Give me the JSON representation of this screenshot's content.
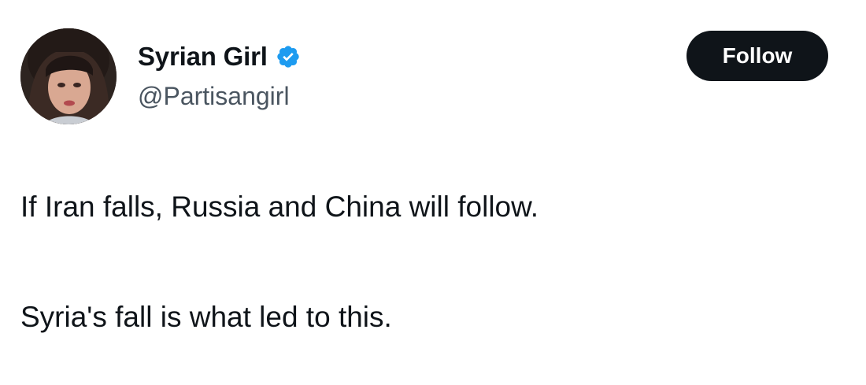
{
  "author": {
    "display_name": "Syrian Girl",
    "handle": "@Partisangirl",
    "verified": true
  },
  "follow_button": {
    "label": "Follow"
  },
  "tweet": {
    "paragraphs": [
      "If Iran falls, Russia and China will follow.",
      "Syria's fall is what led to this."
    ]
  },
  "colors": {
    "verified_badge": "#1d9bf0",
    "button_bg": "#0f1419",
    "text_primary": "#0f1419",
    "text_secondary": "#4a5560"
  },
  "icons": {
    "verified": "verified-badge-icon"
  }
}
